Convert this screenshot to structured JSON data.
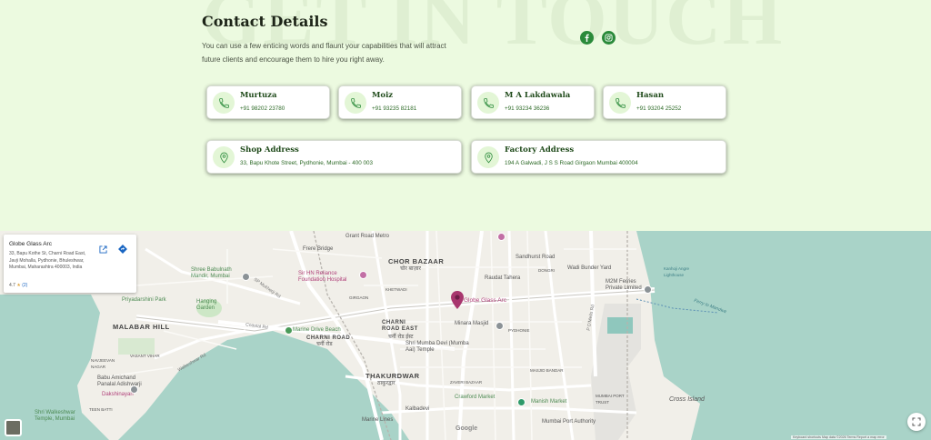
{
  "section": {
    "watermark": "GET IN TOUCH",
    "title": "Contact Details",
    "intro": "You can use a few enticing words and flaunt your capabilities that will attract future clients and encourage them to hire you right away."
  },
  "social": [
    {
      "name": "facebook-icon"
    },
    {
      "name": "instagram-icon"
    }
  ],
  "contacts": [
    {
      "name": "Murtuza",
      "phone": "+91 98202 23780",
      "icon": "phone-icon"
    },
    {
      "name": "Moiz",
      "phone": "+91 93235 82181",
      "icon": "phone-icon"
    },
    {
      "name": "M A Lakdawala",
      "phone": "+91 93234 36236",
      "icon": "phone-icon"
    },
    {
      "name": "Hasan",
      "phone": "+91 93204 25252",
      "icon": "phone-icon"
    }
  ],
  "addresses": [
    {
      "name": "Shop Address",
      "value": "33, Bapu Khote Street, Pydhonie, Mumbai - 400 003",
      "icon": "location-icon"
    },
    {
      "name": "Factory Address",
      "value": "194 A Galwadi, J S S Road Girgaon Mumbai 400004",
      "icon": "location-icon"
    }
  ],
  "colors": {
    "accent": "#2a8a3a",
    "background": "#ecfae0",
    "name_text": "#1f4a1a"
  },
  "map": {
    "place": {
      "name": "Globe Glass Arc",
      "address": "33, Bapu Kothe St, Charni Road East, Javji Mohalla, Pydhonie, Bhuleshwar, Mumbai, Maharashtra 400003, India",
      "rating": "4.7",
      "review_count": "(2)",
      "pin_label": "Globe Glass Arc"
    },
    "labels": {
      "malabar_hill": "MALABAR HILL",
      "chor_bazaar": "CHOR BAZAAR",
      "chor_bazaar_hi": "चोर बाज़ार",
      "charni_road_east": "CHARNI ROAD EAST",
      "charni_road_east_hi": "चर्नी रोड ईस्ट",
      "charni_road": "CHARNI ROAD",
      "charni_road_hi": "चर्नी रोड",
      "thakurdwar": "THAKURDWAR",
      "thakurdwar_hi": "ठाकुरद्वार",
      "grant_road_metro": "Grant Road Metro",
      "frere_bridge": "Frere Bridge",
      "babulnath": "Shree Babulnath Mandir, Mumbai",
      "hn_reliance": "Sir HN Reliance Foundation Hospital",
      "priyadarshini": "Priyadarshini Park",
      "hanging_garden": "Hanging Garden",
      "marine_drive_beach": "Marine Drive Beach",
      "minara_masjid": "Minara Masjid",
      "raudat_tahera": "Raudat Tahera",
      "wadi_bunder": "Wadi Bunder Yard",
      "m2m_ferries": "M2M Ferries Private Limited",
      "mumba_devi": "Shri Mumba Devi (Mumba Aai) Temple",
      "crawford": "Crawford Market",
      "manish_market": "Manish Market",
      "mumbai_port": "Mumbai Port Authority",
      "kalbadevi": "Kalbadevi",
      "marine_lines": "Marine Lines",
      "babu_amichand": "Babu Amichand Panalal Adishwarji",
      "dakshinayan": "Dakshinayan",
      "walkeshwar": "Shri Walkeshwar Temple, Mumbai",
      "cross_island": "Cross Island",
      "kanhoji": "Kanhoji Angre Lighthouse",
      "mumbai_port_trust": "MUMBAI PORT TRUST",
      "masjid_bandar": "MASJID BANDAR",
      "zaveri_bazaar": "ZAVERI BAZAAR",
      "pydhonie": "PYDHONIE",
      "dongri": "DONGRI",
      "sandhurst": "Sandhurst Road",
      "girgaon": "GIRGAON",
      "khetwadi": "KHETWADI",
      "vasant_vihar": "VASANT VIHAR",
      "nariman": "NAVJEEVAN NAGAR",
      "teen_batti": "TEEN BATTI",
      "ferry_to_mandwa": "Ferry to Mandwa",
      "google": "Google"
    },
    "roads": {
      "coastal_rd": "Coastal Rd",
      "walkeshwar_rd": "Walkeshwar Rd",
      "p_dmello_rd": "P D'Mello Rd",
      "sp_mukherjee": "SP Mukherji Rd"
    },
    "footer": "Keyboard shortcuts   Map data ©2026   Terms   Report a map error"
  }
}
